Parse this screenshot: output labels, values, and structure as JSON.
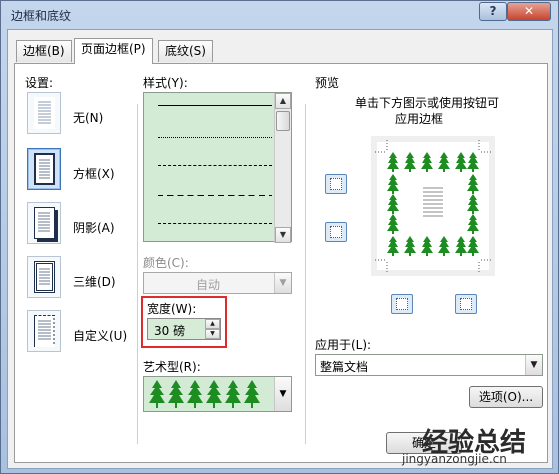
{
  "window": {
    "title": "边框和底纹",
    "help_label": "?",
    "close_label": "✕"
  },
  "tabs": [
    {
      "label": "边框(B)"
    },
    {
      "label": "页面边框(P)"
    },
    {
      "label": "底纹(S)"
    }
  ],
  "settings": {
    "heading": "设置:",
    "items": [
      {
        "label": "无(N)"
      },
      {
        "label": "方框(X)"
      },
      {
        "label": "阴影(A)"
      },
      {
        "label": "三维(D)"
      },
      {
        "label": "自定义(U)"
      }
    ]
  },
  "style": {
    "heading": "样式(Y):"
  },
  "color": {
    "heading": "颜色(C):",
    "value": "自动"
  },
  "width": {
    "heading": "宽度(W):",
    "value": "30 磅"
  },
  "art": {
    "heading": "艺术型(R):",
    "icon": "tree-icon"
  },
  "preview": {
    "heading": "预览",
    "instruction_line1": "单击下方图示或使用按钮可",
    "instruction_line2": "应用边框"
  },
  "apply_to": {
    "heading": "应用于(L):",
    "value": "整篇文档"
  },
  "options_button": "选项(O)...",
  "ok_button": "确定",
  "watermark": {
    "text_line1": "经验总结",
    "text_line2": "jingyanzongjie.cn"
  },
  "colors": {
    "art_tree": "#1d8d22",
    "highlight": "#e02b2b",
    "list_bg": "#d3ead5"
  }
}
